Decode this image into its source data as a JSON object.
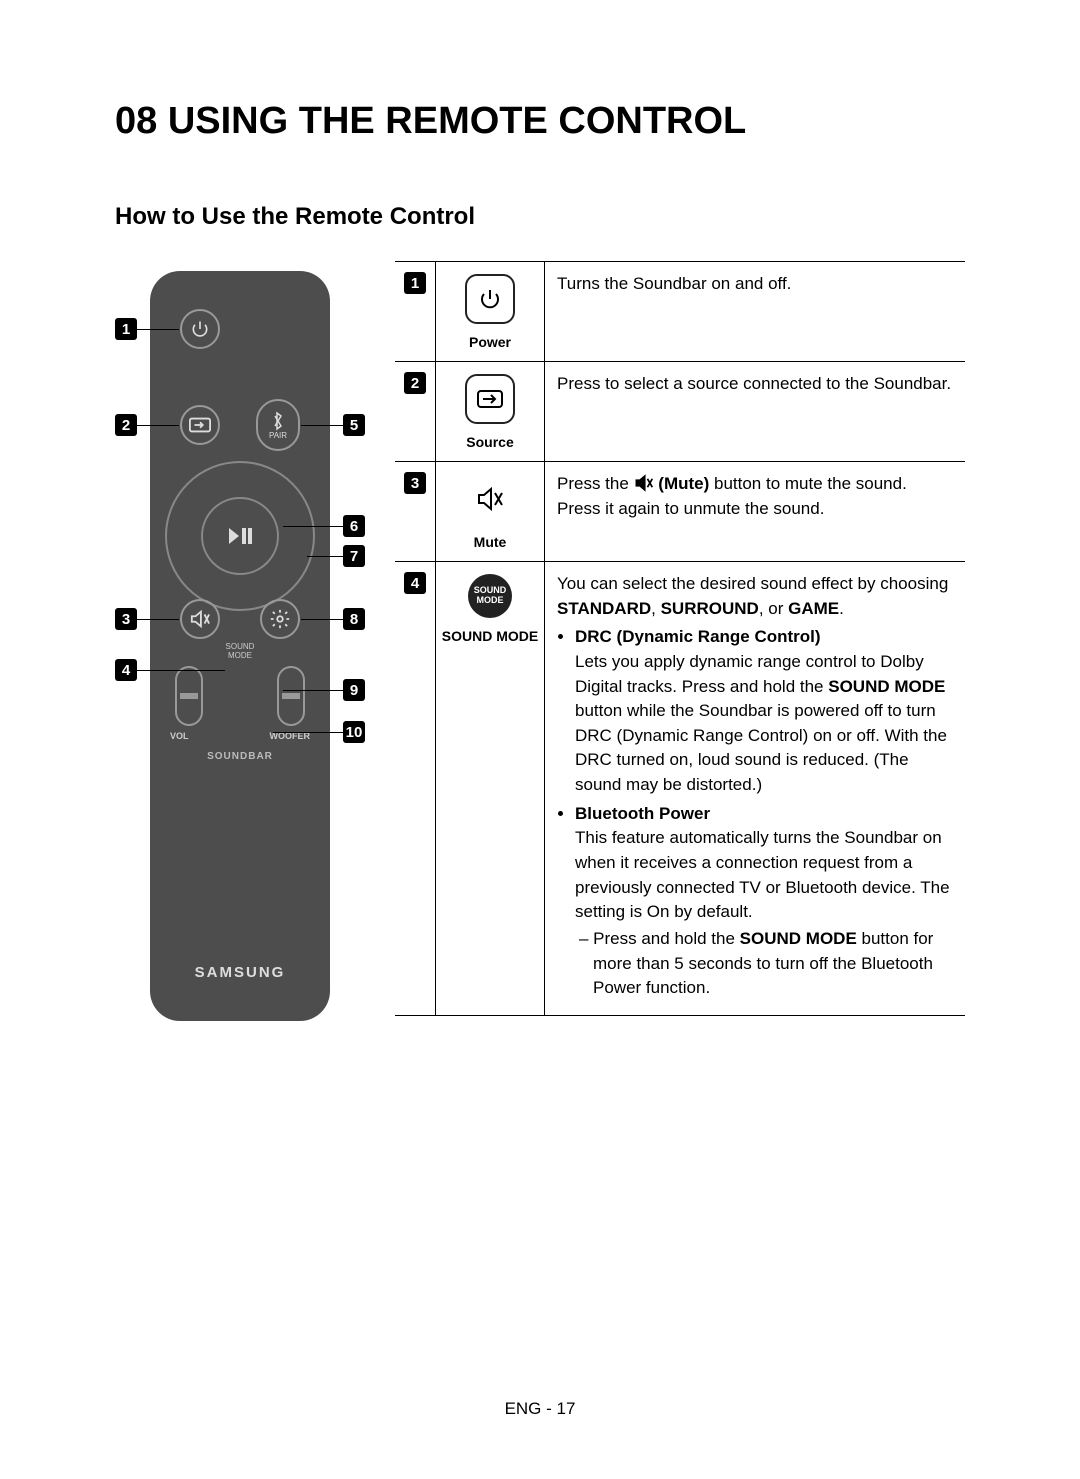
{
  "chapter_heading": "08  USING THE REMOTE CONTROL",
  "section_heading": "How to Use the Remote Control",
  "remote": {
    "pair_label": "PAIR",
    "sound_mode_small": "SOUND\nMODE",
    "vol_label": "VOL",
    "woofer_label": "WOOFER",
    "soundbar_label": "SOUNDBAR",
    "brand": "SAMSUNG",
    "callouts": {
      "1": "1",
      "2": "2",
      "3": "3",
      "4": "4",
      "5": "5",
      "6": "6",
      "7": "7",
      "8": "8",
      "9": "9",
      "10": "10"
    }
  },
  "table": {
    "rows": [
      {
        "num": "1",
        "label": "Power",
        "desc_plain": "Turns the Soundbar on and off."
      },
      {
        "num": "2",
        "label": "Source",
        "desc_plain": "Press to select a source connected to the Soundbar."
      },
      {
        "num": "3",
        "label": "Mute",
        "desc_prefix": "Press the ",
        "desc_bold1": "(Mute)",
        "desc_suffix": " button to mute the sound. Press it again to unmute the sound."
      },
      {
        "num": "4",
        "label": "SOUND MODE",
        "icon_text": "SOUND\nMODE",
        "intro_a": "You can select the desired sound effect by choosing ",
        "intro_b1": "STANDARD",
        "intro_sep1": ", ",
        "intro_b2": "SURROUND",
        "intro_sep2": ", or ",
        "intro_b3": "GAME",
        "intro_end": ".",
        "bullets": [
          {
            "title": "DRC (Dynamic Range Control)",
            "body_a": "Lets you apply dynamic range control to Dolby Digital tracks. Press and hold the ",
            "body_bold": "SOUND MODE",
            "body_b": " button while the Soundbar is powered off to turn DRC (Dynamic Range Control) on or off. With the DRC turned on, loud sound is reduced. (The sound may be distorted.)"
          },
          {
            "title": "Bluetooth Power",
            "body": "This feature automatically turns the Soundbar on when it receives a connection request from a previously connected TV or Bluetooth device. The setting is On by default.",
            "sub_prefix": "–   Press and hold the ",
            "sub_bold": "SOUND MODE",
            "sub_suffix": " button for more than 5 seconds to turn off the Bluetooth Power function."
          }
        ]
      }
    ]
  },
  "footer": "ENG - 17"
}
